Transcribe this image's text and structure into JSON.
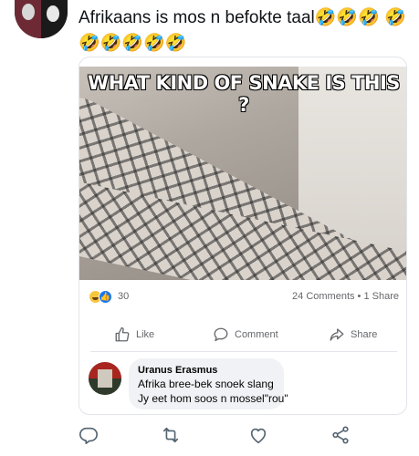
{
  "tweet": {
    "text": "Afrikaans is mos n befokte taal🤣🤣🤣 🤣🤣🤣🤣🤣🤣"
  },
  "post": {
    "image_caption": "WHAT KIND OF SNAKE IS THIS ?",
    "reactions_count": "30",
    "comments_shares": "24 Comments • 1 Share",
    "actions": {
      "like": "Like",
      "comment": "Comment",
      "share": "Share"
    },
    "comment": {
      "author": "Uranus Erasmus",
      "line1": "Afrika bree-bek snoek slang",
      "line2": "Jy eet hom soos n mossel\"rou\""
    }
  },
  "icons": {
    "tweet_actions": [
      "reply-icon",
      "retweet-icon",
      "like-heart-icon",
      "share-icon"
    ]
  },
  "colors": {
    "text": "#0f1419",
    "fb_blue": "#1877f2",
    "muted": "#65676b",
    "bubble": "#f0f2f5"
  }
}
